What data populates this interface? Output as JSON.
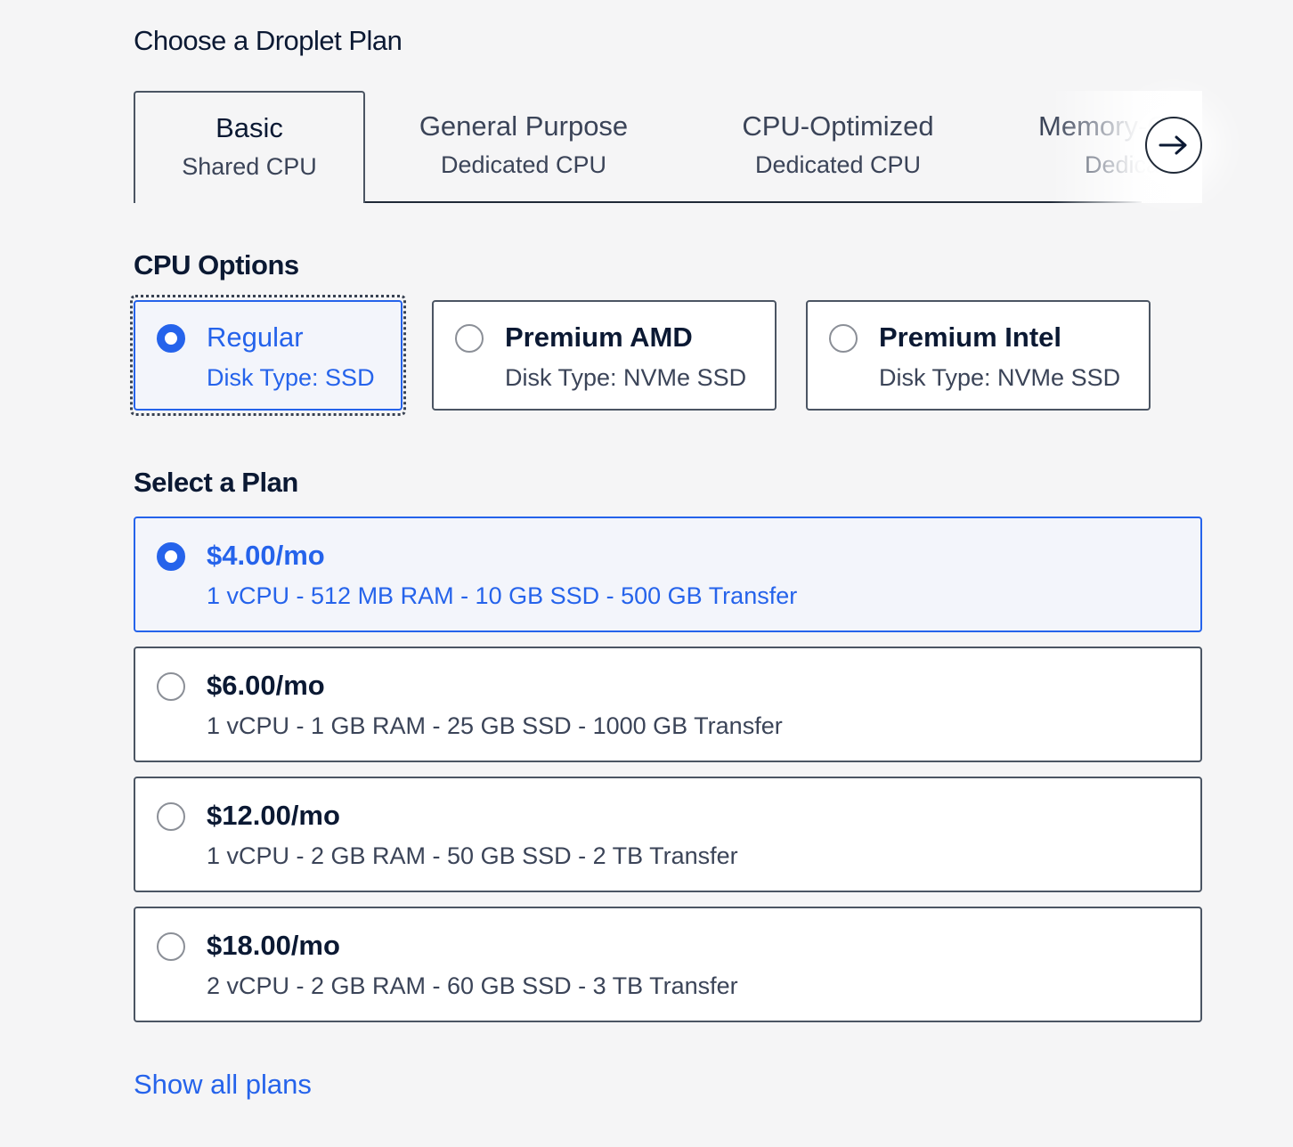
{
  "sections": {
    "plan_title": "Choose a Droplet Plan",
    "cpu_title": "CPU Options",
    "select_title": "Select a Plan"
  },
  "tabs": [
    {
      "title": "Basic",
      "sub": "Shared CPU",
      "active": true
    },
    {
      "title": "General Purpose",
      "sub": "Dedicated CPU",
      "active": false
    },
    {
      "title": "CPU-Optimized",
      "sub": "Dedicated CPU",
      "active": false
    },
    {
      "title": "Memory-Optimized",
      "sub": "Dedicated CPU",
      "active": false
    }
  ],
  "cpu_options": [
    {
      "title": "Regular",
      "sub": "Disk Type: SSD",
      "selected": true
    },
    {
      "title": "Premium AMD",
      "sub": "Disk Type: NVMe SSD",
      "selected": false
    },
    {
      "title": "Premium Intel",
      "sub": "Disk Type: NVMe SSD",
      "selected": false
    }
  ],
  "plans": [
    {
      "price": "$4.00/mo",
      "specs": "1 vCPU - 512 MB RAM - 10 GB SSD - 500 GB Transfer",
      "selected": true
    },
    {
      "price": "$6.00/mo",
      "specs": "1 vCPU - 1 GB RAM - 25 GB SSD - 1000 GB Transfer",
      "selected": false
    },
    {
      "price": "$12.00/mo",
      "specs": "1 vCPU - 2 GB RAM - 50 GB SSD - 2 TB Transfer",
      "selected": false
    },
    {
      "price": "$18.00/mo",
      "specs": "2 vCPU - 2 GB RAM - 60 GB SSD - 3 TB Transfer",
      "selected": false
    }
  ],
  "show_all_label": "Show all plans",
  "icons": {
    "scroll": "arrow-right-icon"
  },
  "colors": {
    "accent": "#2563eb",
    "text": "#0b1933",
    "muted": "#3b4458",
    "border": "#4b5563",
    "background": "#f5f5f6"
  }
}
